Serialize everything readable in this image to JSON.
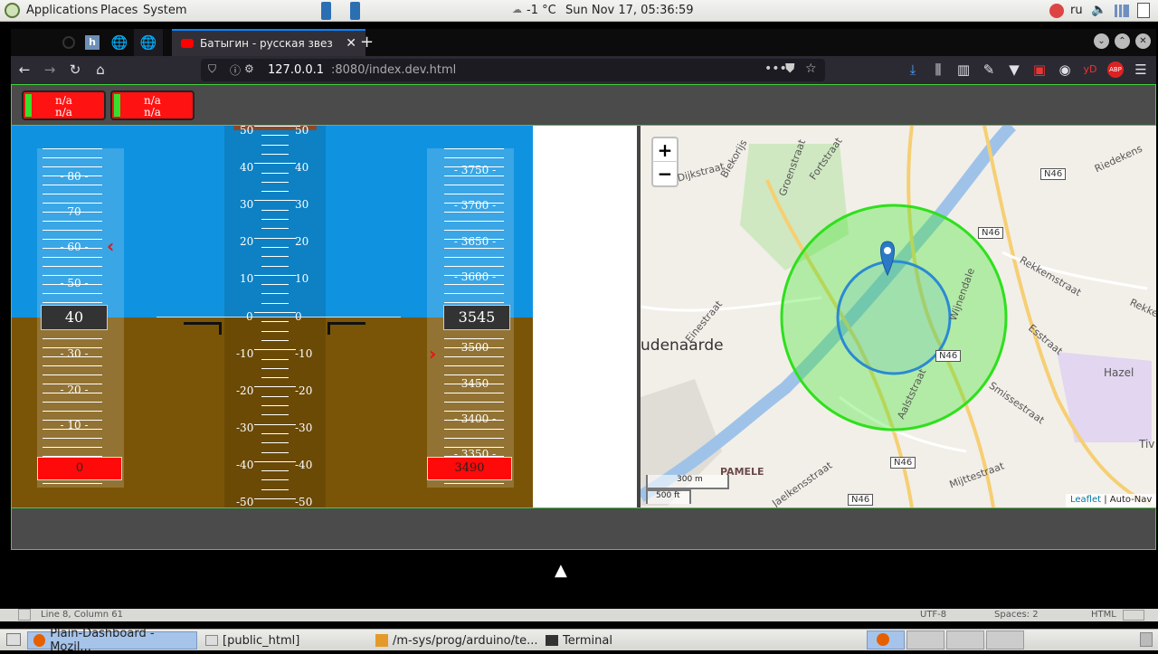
{
  "desktop": {
    "menus": [
      "Applications",
      "Places",
      "System"
    ],
    "weather": "-1 °C",
    "clock": "Sun Nov 17, 05:36:59",
    "keyboard_layout": "ru"
  },
  "browser": {
    "active_tab_title": "Батыгин - русская звез",
    "url_host": "127.0.0.1",
    "url_rest": ":8080/index.dev.html"
  },
  "dashboard": {
    "status_boxes": [
      {
        "line1": "n/a",
        "line2": "n/a"
      },
      {
        "line1": "n/a",
        "line2": "n/a"
      }
    ],
    "speed_tape": {
      "labels": [
        "- 80 -",
        "- 70 -",
        "- 60 -",
        "- 50 -",
        "- 30 -",
        "- 20 -",
        "- 10 -"
      ],
      "current": "40",
      "bug": "0"
    },
    "pitch_ladder": {
      "labels_left": [
        "50",
        "40",
        "30",
        "20",
        "10",
        "0",
        "-10",
        "-20",
        "-30",
        "-40",
        "-50"
      ],
      "labels_right": [
        "50",
        "40",
        "30",
        "20",
        "10",
        "0",
        "-10",
        "-20",
        "-30",
        "-40",
        "-50"
      ]
    },
    "alt_tape": {
      "labels": [
        "- 3750 -",
        "- 3700 -",
        "- 3650 -",
        "- 3600 -",
        "- 3500 -",
        "- 3450 -",
        "- 3400 -",
        "- 3350 -"
      ],
      "current": "3545",
      "bug": "3490"
    }
  },
  "map": {
    "zoom_in": "+",
    "zoom_out": "−",
    "place_labels": [
      "udenaarde",
      "PAMELE"
    ],
    "street_labels": [
      "Fortstraat",
      "Groenstraat",
      "Dijkstraat",
      "Einestraat",
      "Wijnendale",
      "Aalststraat",
      "Rekkemstraat",
      "Esstraat",
      "Riedekens",
      "Smissestraat",
      "Mijttestraat",
      "Jaelkensstraat",
      "Hazel",
      "Rekke",
      "Tiv",
      "Biekorijs"
    ],
    "road_shields": [
      "N46",
      "N46",
      "N46",
      "N46",
      "N46"
    ],
    "scale_m": "300 m",
    "scale_ft": "500 ft",
    "attribution_link": "Leaflet",
    "attribution_text": "| Auto-Nav"
  },
  "editor_status": {
    "position": "Line 8, Column 61",
    "encoding": "UTF-8",
    "spaces": "Spaces: 2",
    "language": "HTML"
  },
  "taskbar": {
    "items": [
      "Plain-Dashboard - Mozil...",
      "[public_html]",
      "/m-sys/prog/arduino/te...",
      "Terminal"
    ]
  }
}
